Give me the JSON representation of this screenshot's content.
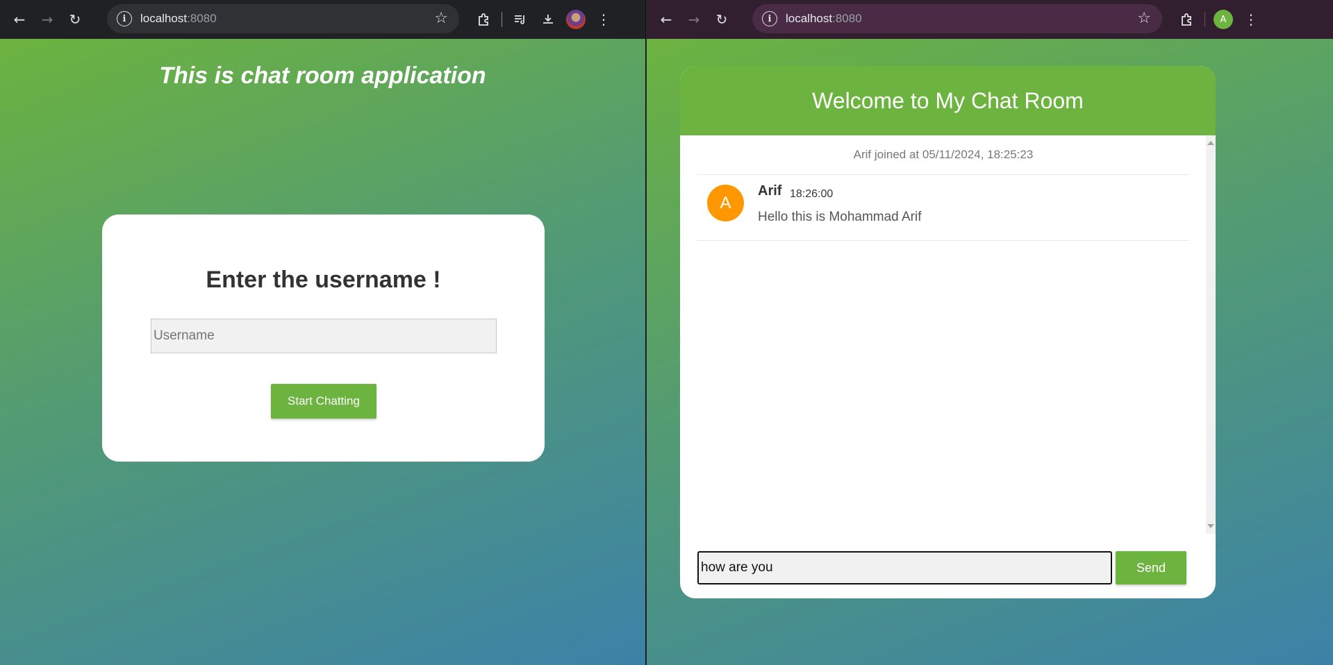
{
  "browsers": {
    "left": {
      "url_host": "localhost",
      "url_port": ":8080",
      "profile_avatar": ""
    },
    "right": {
      "url_host": "localhost",
      "url_port": ":8080",
      "profile_initial": "A"
    }
  },
  "login_page": {
    "heading": "This is chat room application",
    "card_title": "Enter the username !",
    "username_placeholder": "Username",
    "start_button": "Start Chatting"
  },
  "chat_page": {
    "header": "Welcome to My Chat Room",
    "join_event": "Arif joined at 05/11/2024, 18:25:23",
    "message": {
      "avatar_initial": "A",
      "sender": "Arif",
      "time": "18:26:00",
      "text": "Hello this is Mohammad Arif"
    },
    "input_value": "how are you",
    "send_button": "Send"
  },
  "colors": {
    "accent": "#6cb33f",
    "avatar": "#ff9800",
    "gradient_end": "#3c82a8"
  },
  "icons": [
    "back-icon",
    "forward-icon",
    "reload-icon",
    "info-icon",
    "star-icon",
    "extensions-icon",
    "media-icon",
    "download-icon",
    "menu-icon"
  ]
}
